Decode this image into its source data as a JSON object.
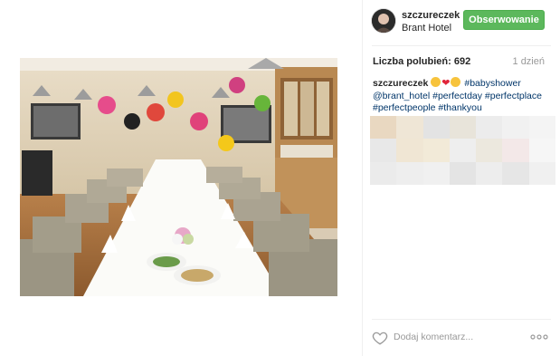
{
  "header": {
    "username": "szczureczek",
    "location": "Brant Hotel",
    "follow_label": "Obserwowanie"
  },
  "stats": {
    "likes_label": "Liczba polubień: 692",
    "time_ago": "1 dzień"
  },
  "caption": {
    "user": "szczureczek",
    "hashtags": [
      "#babyshower",
      "@brant_hotel",
      "#perfectday",
      "#perfectplace",
      "#perfectpeople",
      "#thankyou"
    ]
  },
  "comment": {
    "placeholder": "Dodaj komentarz..."
  },
  "colors": {
    "follow_green": "#5cb85c",
    "tag_blue": "#003569",
    "muted": "#999999"
  },
  "icons": {
    "like": "heart-outline-icon",
    "more": "ellipsis-icon"
  }
}
